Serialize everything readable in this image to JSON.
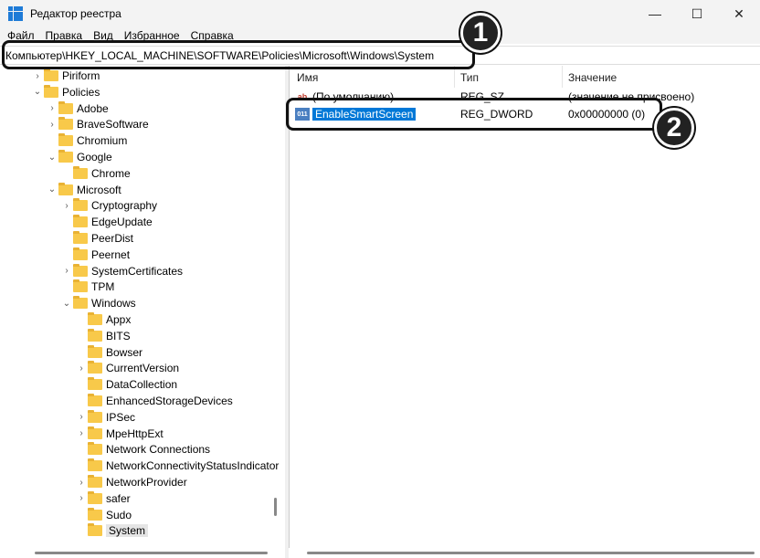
{
  "window": {
    "title": "Редактор реестра",
    "minimize": "—",
    "maximize": "☐",
    "close": "✕"
  },
  "menu": [
    "Файл",
    "Правка",
    "Вид",
    "Избранное",
    "Справка"
  ],
  "address": "Компьютер\\HKEY_LOCAL_MACHINE\\SOFTWARE\\Policies\\Microsoft\\Windows\\System",
  "tree": [
    {
      "label": "Piriform",
      "level": 1,
      "chevron": "›"
    },
    {
      "label": "Policies",
      "level": 1,
      "chevron": "⌄"
    },
    {
      "label": "Adobe",
      "level": 2,
      "chevron": "›"
    },
    {
      "label": "BraveSoftware",
      "level": 2,
      "chevron": "›"
    },
    {
      "label": "Chromium",
      "level": 2,
      "chevron": ""
    },
    {
      "label": "Google",
      "level": 2,
      "chevron": "⌄"
    },
    {
      "label": "Chrome",
      "level": 3,
      "chevron": ""
    },
    {
      "label": "Microsoft",
      "level": 2,
      "chevron": "⌄"
    },
    {
      "label": "Cryptography",
      "level": 3,
      "chevron": "›"
    },
    {
      "label": "EdgeUpdate",
      "level": 3,
      "chevron": ""
    },
    {
      "label": "PeerDist",
      "level": 3,
      "chevron": ""
    },
    {
      "label": "Peernet",
      "level": 3,
      "chevron": ""
    },
    {
      "label": "SystemCertificates",
      "level": 3,
      "chevron": "›"
    },
    {
      "label": "TPM",
      "level": 3,
      "chevron": ""
    },
    {
      "label": "Windows",
      "level": 3,
      "chevron": "⌄"
    },
    {
      "label": "Appx",
      "level": 4,
      "chevron": ""
    },
    {
      "label": "BITS",
      "level": 4,
      "chevron": ""
    },
    {
      "label": "Bowser",
      "level": 4,
      "chevron": ""
    },
    {
      "label": "CurrentVersion",
      "level": 4,
      "chevron": "›"
    },
    {
      "label": "DataCollection",
      "level": 4,
      "chevron": ""
    },
    {
      "label": "EnhancedStorageDevices",
      "level": 4,
      "chevron": ""
    },
    {
      "label": "IPSec",
      "level": 4,
      "chevron": "›"
    },
    {
      "label": "MpeHttpExt",
      "level": 4,
      "chevron": "›"
    },
    {
      "label": "Network Connections",
      "level": 4,
      "chevron": ""
    },
    {
      "label": "NetworkConnectivityStatusIndicator",
      "level": 4,
      "chevron": ""
    },
    {
      "label": "NetworkProvider",
      "level": 4,
      "chevron": "›"
    },
    {
      "label": "safer",
      "level": 4,
      "chevron": "›"
    },
    {
      "label": "Sudo",
      "level": 4,
      "chevron": ""
    },
    {
      "label": "System",
      "level": 4,
      "chevron": "",
      "selected": true
    }
  ],
  "columns": {
    "name": "Имя",
    "type": "Тип",
    "value": "Значение"
  },
  "values": [
    {
      "icon": "ab",
      "name": "(По умолчанию)",
      "type": "REG_SZ",
      "value": "(значение не присвоено)"
    },
    {
      "icon": "011",
      "name": "EnableSmartScreen",
      "type": "REG_DWORD",
      "value": "0x00000000 (0)",
      "selected": true
    }
  ],
  "callouts": {
    "one": "1",
    "two": "2"
  }
}
